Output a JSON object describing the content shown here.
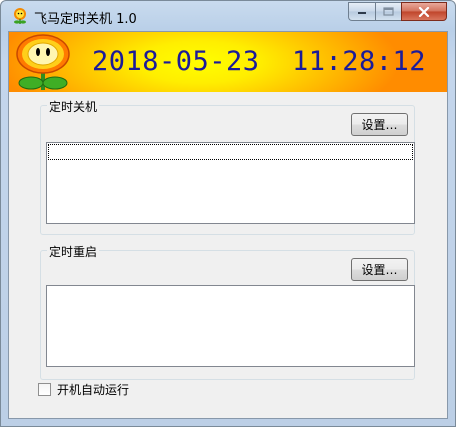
{
  "window": {
    "title": "飞马定时关机 1.0",
    "icon": "flower-icon"
  },
  "caption_buttons": {
    "minimize_icon": "minimize-icon",
    "maximize_icon": "maximize-icon",
    "close_icon": "close-icon"
  },
  "banner": {
    "date": "2018-05-23",
    "time": "11:28:12",
    "mascot_icon": "flower-mascot",
    "date_color": "#1b1b99",
    "gradient_colors": [
      "#ffff00",
      "#ff8c00"
    ]
  },
  "shutdown_group": {
    "label": "定时关机",
    "settings_button": "设置…",
    "items": []
  },
  "restart_group": {
    "label": "定时重启",
    "settings_button": "设置…",
    "items": []
  },
  "autostart": {
    "label": "开机自动运行",
    "checked": false
  }
}
